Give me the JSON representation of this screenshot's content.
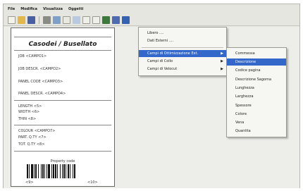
{
  "menubar": [
    "File",
    "Modifica",
    "Visualizza",
    "Oggetti"
  ],
  "toolbar_icons": [
    "new-icon",
    "open-icon",
    "save-icon",
    "print-icon",
    "preview-icon",
    "text-icon",
    "image-icon",
    "line-icon",
    "rect-icon",
    "barcode-icon",
    "field-icon",
    "table-icon"
  ],
  "label": {
    "title": "Casodei / Busellato",
    "lines": [
      "JOB   <CAMPO1>",
      "JOB DESCR.  <CAMPO2>",
      "PANEL CODE  <CAMPO3>",
      "PANEL DESCR.  <CAMPO4>",
      "LENGTH  <5>",
      "WIDTH  <6>",
      "THIN  <8>",
      "COLOUR  <CAMPO7>",
      "PART. Q.TY  <7>",
      "TOT. Q.TY  <8>"
    ],
    "barcode_caption": "Property code",
    "barcode_left": "<9>",
    "barcode_right": "<10>"
  },
  "menu1": {
    "items": [
      "Libero ....",
      "Dati Esterni ....",
      "Campi di Ottimizzazione Ext.",
      "Campi di Collo",
      "Campi di Velocut"
    ],
    "selected_index": 2
  },
  "menu2": {
    "items": [
      "Commessa",
      "Descrizione",
      "Codice pagina",
      "Descrizione Sagoma",
      "Lunghezza",
      "Larghezza",
      "Spessore",
      "Colore",
      "Vena",
      "Quantita"
    ],
    "selected_index": 1
  },
  "colors": {
    "selection": "#3367c9",
    "menu_bg": "#f6f6f2",
    "window_bg": "#e6e6e0"
  }
}
